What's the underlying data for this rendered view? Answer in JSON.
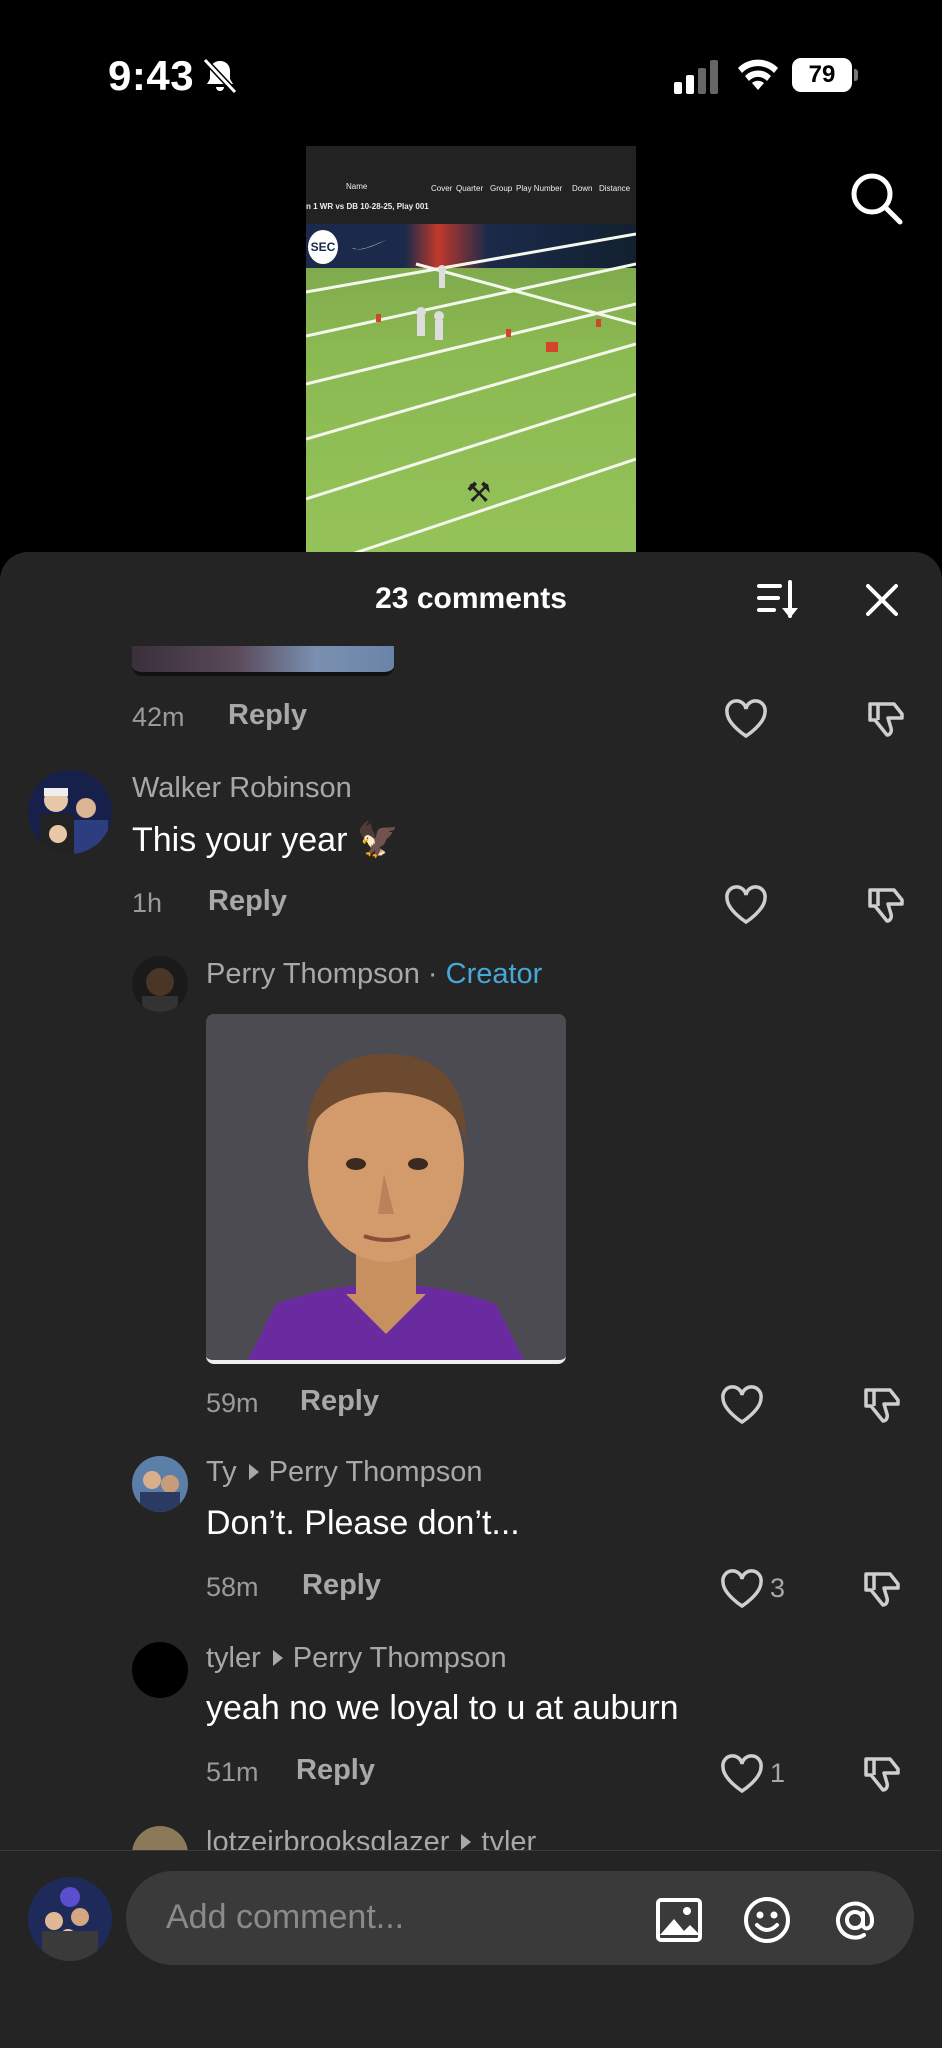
{
  "status_bar": {
    "time": "9:43",
    "battery": "79"
  },
  "sheet": {
    "title": "23 comments"
  },
  "comments": [
    {
      "time": "42m",
      "reply": "Reply"
    },
    {
      "username": "Walker Robinson",
      "text": "This your year 🦅",
      "time": "1h",
      "reply": "Reply"
    },
    {
      "username": "Perry Thompson",
      "separator": " · ",
      "badge": "Creator",
      "time": "59m",
      "reply": "Reply"
    },
    {
      "username": "Ty",
      "reply_to": "Perry Thompson",
      "text": "Don’t. Please don’t...",
      "time": "58m",
      "reply": "Reply",
      "likes": "3"
    },
    {
      "username": "tyler",
      "reply_to": "Perry Thompson",
      "text": "yeah no we loyal to u at auburn",
      "time": "51m",
      "reply": "Reply",
      "likes": "1"
    },
    {
      "username": "lotzeirbrooksglazer",
      "reply_to": "tyler"
    }
  ],
  "video_overlay": {
    "name_label": "Name",
    "columns": [
      "Cover",
      "Quarter",
      "Group",
      "Play Number",
      "Down",
      "Distance"
    ],
    "play_title": "n 1 WR vs DB 10-28-25, Play 001",
    "logo": "SEC"
  },
  "input": {
    "placeholder": "Add comment..."
  },
  "icons": {
    "search": "search-icon",
    "sort": "sort-icon",
    "close": "close-icon",
    "heart": "heart-icon",
    "dislike": "thumbs-down-icon",
    "image": "image-icon",
    "emoji": "emoji-icon",
    "mention": "at-icon"
  },
  "colors": {
    "background": "#000000",
    "sheet": "#242424",
    "creator_badge": "#46a8d6",
    "text_muted": "#a8a8a8"
  }
}
